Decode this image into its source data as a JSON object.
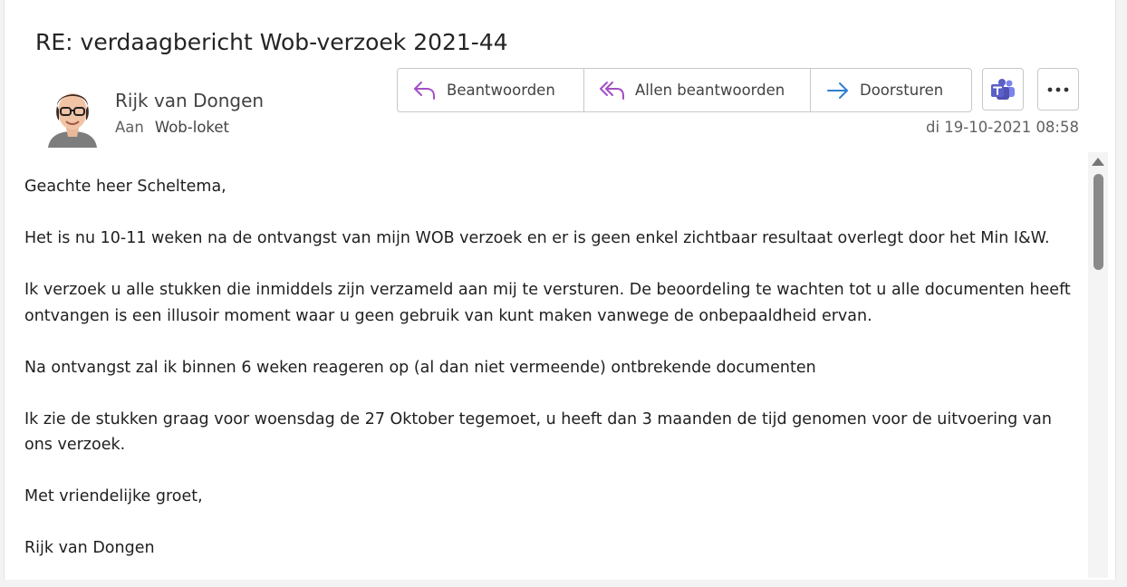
{
  "subject": "RE: verdaagbericht Wob-verzoek 2021-44",
  "sender": {
    "name": "Rijk van Dongen",
    "to_label": "Aan",
    "to_value": "Wob-loket",
    "avatar_icon": "person-avatar"
  },
  "actions": {
    "reply": "Beantwoorden",
    "reply_all": "Allen beantwoorden",
    "forward": "Doorsturen",
    "teams_icon": "microsoft-teams-icon",
    "more_icon": "more-ellipsis-icon"
  },
  "date": "di 19-10-2021 08:58",
  "body": {
    "greeting": "Geachte heer Scheltema,",
    "p1": "Het is nu 10-11 weken na de ontvangst van mijn WOB verzoek en er is geen enkel zichtbaar resultaat overlegt door het Min I&W.",
    "p2": "Ik verzoek u alle stukken die inmiddels zijn verzameld aan mij te versturen. De beoordeling te wachten tot u alle documenten heeft ontvangen is een illusoir moment waar u geen gebruik van kunt maken vanwege de onbepaaldheid ervan.",
    "p3": "Na ontvangst zal ik binnen 6 weken reageren op (al dan niet vermeende) ontbrekende documenten",
    "p4": "Ik zie de stukken graag voor woensdag de 27 Oktober tegemoet, u heeft dan 3 maanden de tijd genomen voor de uitvoering van ons verzoek.",
    "closing": "Met vriendelijke groet,",
    "signature": "Rijk van Dongen"
  },
  "colors": {
    "reply_icon": "#a44ec6",
    "forward_icon": "#2f7fd1",
    "teams_purple": "#5b5fc7"
  }
}
